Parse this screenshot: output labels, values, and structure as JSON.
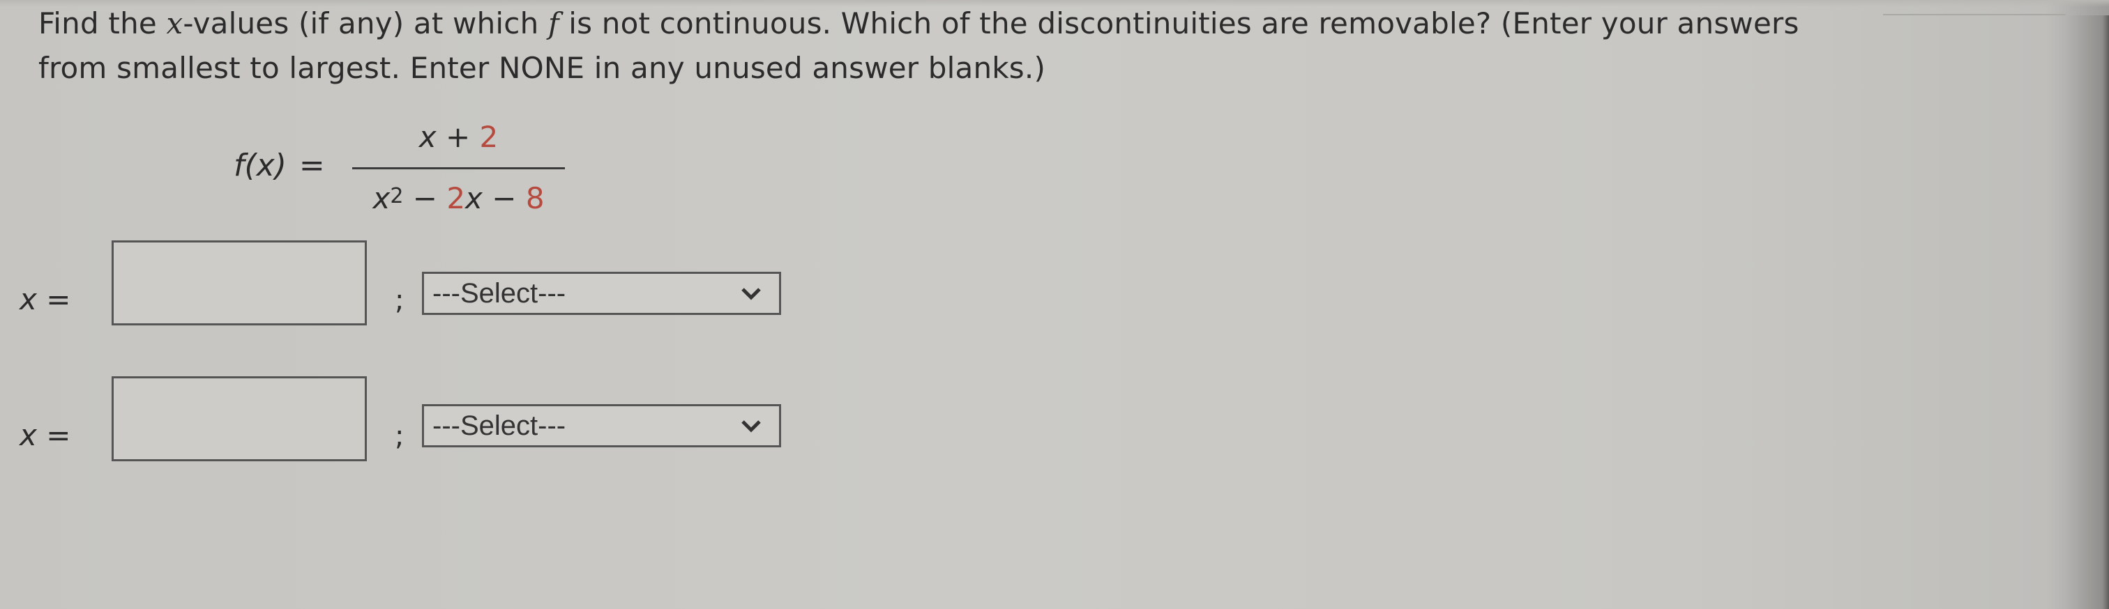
{
  "question": {
    "line1_parts": [
      {
        "text": "Find the ",
        "style": "normal"
      },
      {
        "text": "x",
        "style": "italic"
      },
      {
        "text": "-values (if any) at which ",
        "style": "normal"
      },
      {
        "text": "f",
        "style": "italic"
      },
      {
        "text": " is not continuous. Which of the discontinuities are removable? (Enter your answers",
        "style": "normal"
      }
    ],
    "line2": "from smallest to largest. Enter NONE in any unused answer blanks.)"
  },
  "formula": {
    "lhs": "f(x)",
    "equals": "=",
    "numerator": {
      "var": "x",
      "op": " + ",
      "const": "2"
    },
    "denominator": {
      "var": "x",
      "exp": "2",
      "op1": " − ",
      "coef": "2",
      "var2": "x",
      "op2": " − ",
      "const": "8"
    },
    "highlight_color": "#b64a3f"
  },
  "answers": [
    {
      "label": "x =",
      "value": "",
      "separator": ";",
      "select_value": "---Select---"
    },
    {
      "label": "x =",
      "value": "",
      "separator": ";",
      "select_value": "---Select---"
    }
  ]
}
